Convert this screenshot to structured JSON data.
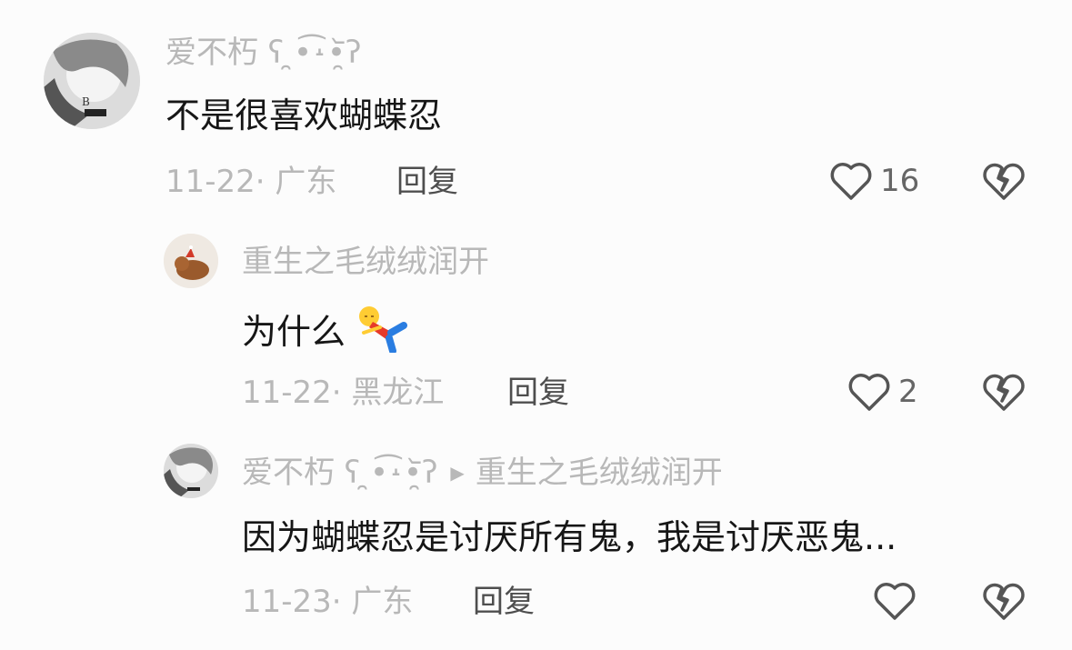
{
  "comments": [
    {
      "username": "爱不朽 ʕ ̯•͡˔•̯᷅ʔ",
      "text": "不是很喜欢蝴蝶忍",
      "meta": "11-22· 广东",
      "reply_label": "回复",
      "likes": "16"
    },
    {
      "username": "重生之毛绒绒润开",
      "text": "为什么",
      "meta": "11-22· 黑龙江",
      "reply_label": "回复",
      "likes": "2"
    },
    {
      "username": "爱不朽 ʕ ̯•͡˔•̯᷅ʔ",
      "reply_to": "重生之毛绒绒润开",
      "text": "因为蝴蝶忍是讨厌所有鬼，我是讨厌恶鬼...",
      "meta": "11-23· 广东",
      "reply_label": "回复",
      "likes": ""
    }
  ],
  "icons": {
    "like": "heart-outline-icon",
    "dislike": "broken-heart-icon",
    "reply_arrow": "triangle-right-icon",
    "sticker": "fallen-figure-sticker"
  },
  "colors": {
    "background": "#fcfcfc",
    "text": "#161616",
    "muted": "#b8b8b8",
    "reply": "#4e4e4e",
    "icon": "#555555"
  }
}
